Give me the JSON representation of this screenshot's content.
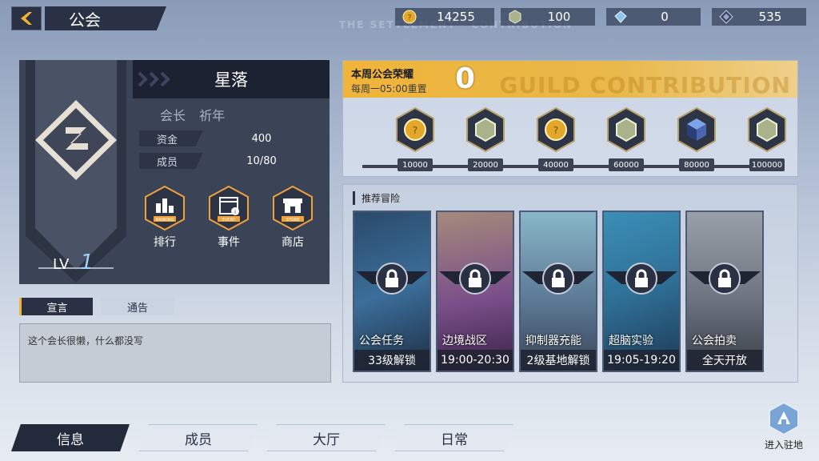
{
  "header": {
    "title": "公会",
    "currencies": [
      {
        "icon": "gold-coin-icon",
        "value": "14255"
      },
      {
        "icon": "guild-medal-icon",
        "value": "100"
      },
      {
        "icon": "diamond-icon",
        "value": "0"
      },
      {
        "icon": "crystal-icon",
        "value": "535"
      }
    ]
  },
  "guild": {
    "name": "星落",
    "leader_label": "会长",
    "leader_name": "祈年",
    "funds_label": "资金",
    "funds_value": "400",
    "members_label": "成员",
    "members_value": "10/80",
    "level_label": "LV",
    "level_value": "1",
    "actions": [
      {
        "label": "排行",
        "badge": "RANKING",
        "icon": "ranking-icon"
      },
      {
        "label": "事件",
        "badge": "EVENT",
        "icon": "event-icon"
      },
      {
        "label": "商店",
        "badge": "STORE",
        "icon": "store-icon"
      }
    ]
  },
  "declaration": {
    "tabs": [
      "宣言",
      "通告"
    ],
    "active_tab": "宣言",
    "text": "这个会长很懒，什么都没写"
  },
  "weekly_honor": {
    "title": "本周公会荣耀",
    "reset": "每周一05:00重置",
    "value": "0",
    "bg_text": "GUILD CONTRIBUTION",
    "rewards": [
      {
        "threshold": "10000",
        "icon": "gold-coin-icon"
      },
      {
        "threshold": "20000",
        "icon": "guild-medal-icon"
      },
      {
        "threshold": "40000",
        "icon": "gold-coin-icon"
      },
      {
        "threshold": "60000",
        "icon": "guild-medal-icon"
      },
      {
        "threshold": "80000",
        "icon": "cube-icon"
      },
      {
        "threshold": "100000",
        "icon": "guild-medal-icon"
      }
    ]
  },
  "recommended": {
    "title": "推荐冒险",
    "cards": [
      {
        "name": "公会任务",
        "status": "33级解锁",
        "color": "#3b6e9a"
      },
      {
        "name": "边境战区",
        "status": "19:00-20:30",
        "color": "#7a4f8a"
      },
      {
        "name": "抑制器充能",
        "status": "2级基地解锁",
        "color": "#5c7a96"
      },
      {
        "name": "超脑实验",
        "status": "19:05-19:20",
        "color": "#2f6f96"
      },
      {
        "name": "公会拍卖",
        "status": "全天开放",
        "color": "#6d7480"
      }
    ]
  },
  "bottom_nav": {
    "tabs": [
      "信息",
      "成员",
      "大厅",
      "日常"
    ],
    "active": "信息",
    "enter_label": "进入驻地"
  }
}
